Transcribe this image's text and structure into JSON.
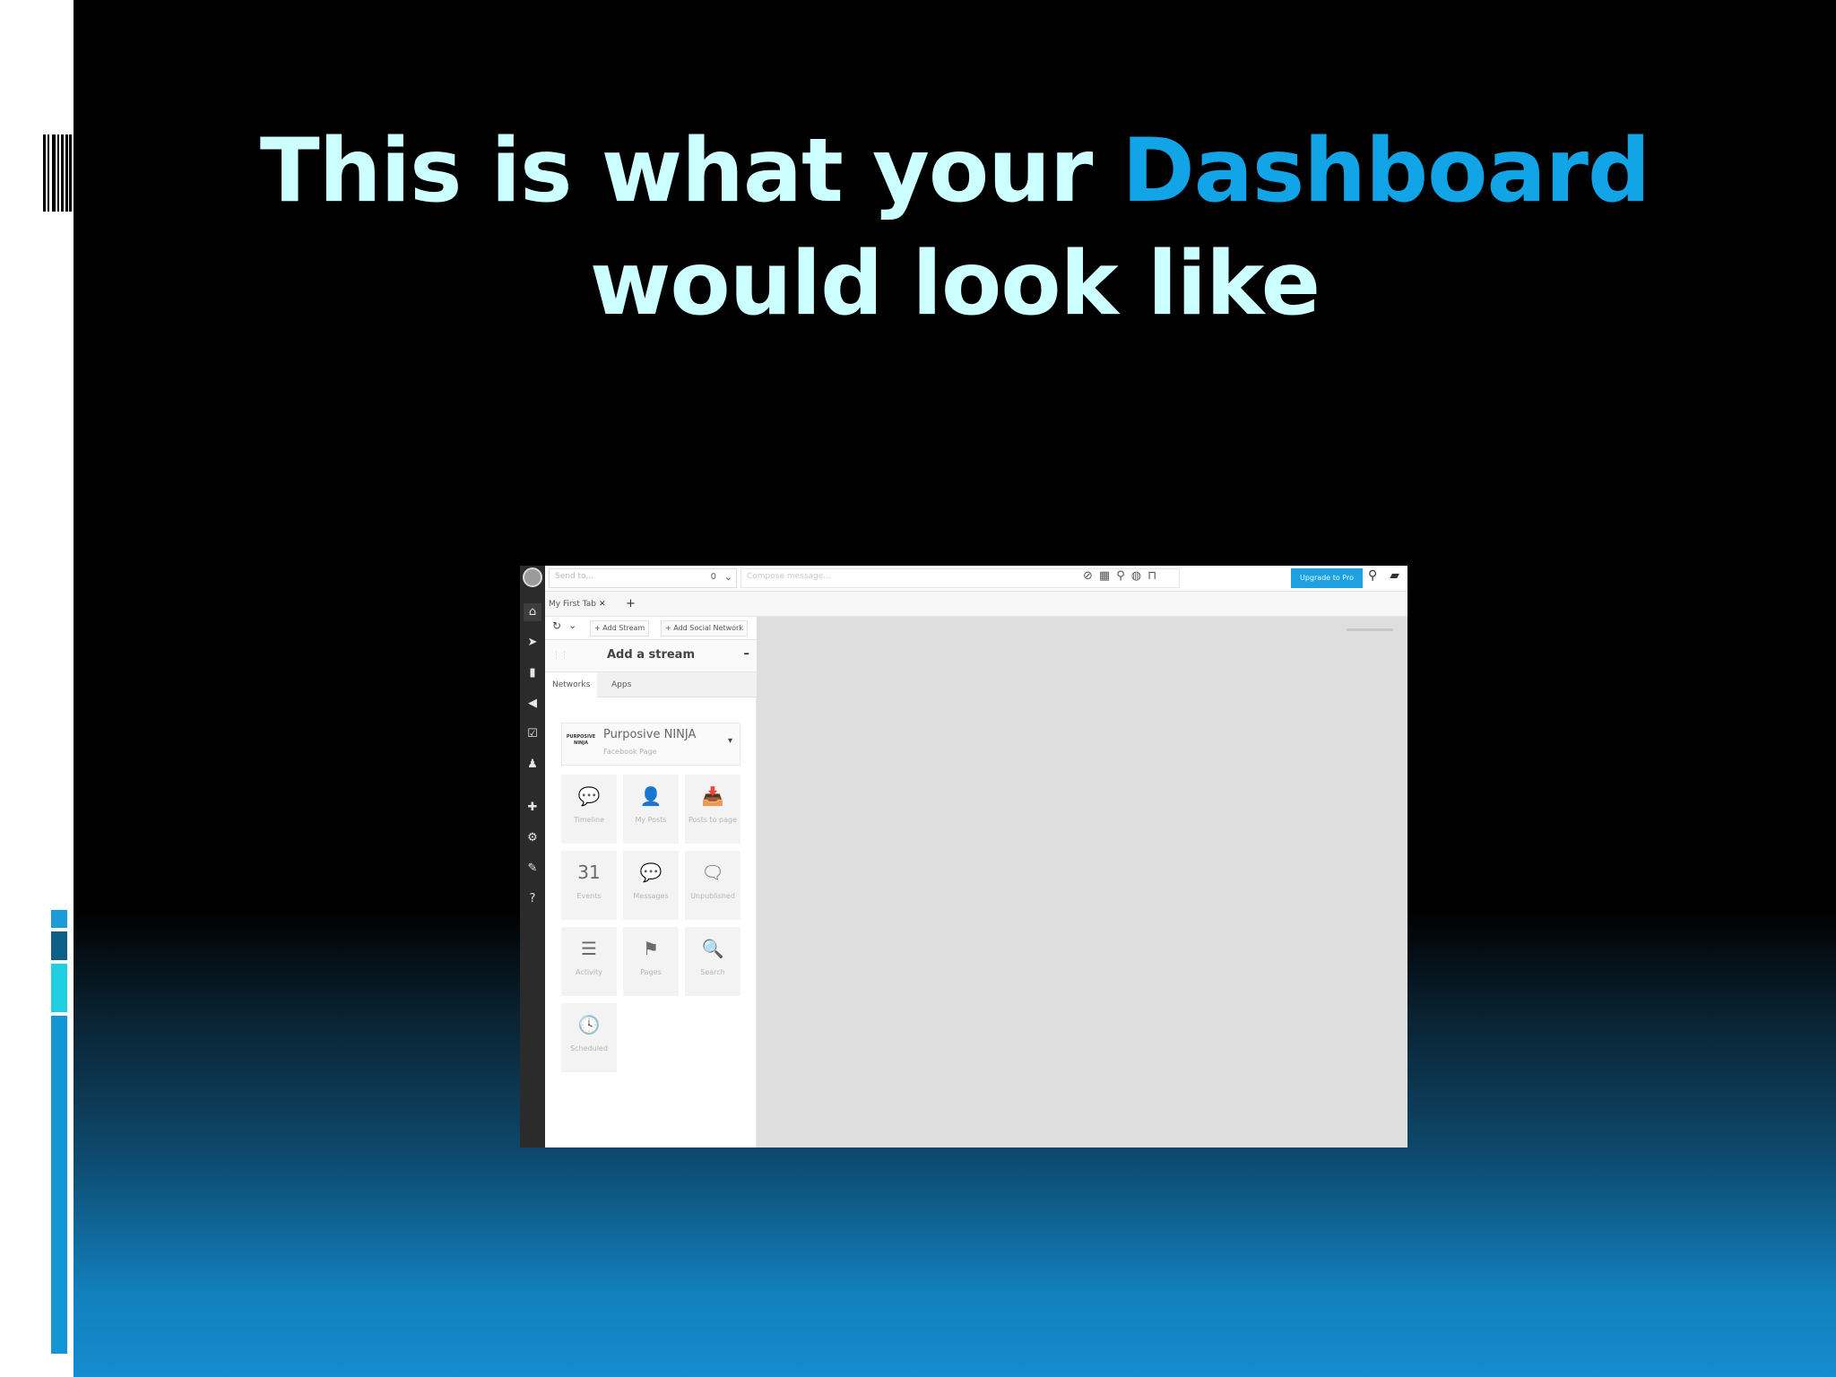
{
  "slide": {
    "title_line1_pre": "This is what your ",
    "title_highlight": "Dashboard",
    "title_line2": "would look like",
    "colors": {
      "title": "#ccffff",
      "highlight": "#11a4e6",
      "accent_bars": [
        "#1b9bd8",
        "#0e5f86",
        "#1fcfe0",
        "#1495d6"
      ]
    }
  },
  "dashboard": {
    "topbar": {
      "send_to_placeholder": "Send to...",
      "profile_count": "0",
      "compose_placeholder": "Compose message...",
      "compose_icons": [
        "attachment-icon",
        "calendar-icon",
        "location-pin-icon",
        "globe-icon",
        "lock-icon"
      ],
      "upgrade_label": "Upgrade to Pro",
      "right_icons": [
        "search-icon",
        "messages-icon"
      ]
    },
    "sidebar_icons": [
      "home-icon",
      "send-icon",
      "analytics-icon",
      "megaphone-icon",
      "assignments-icon",
      "contacts-icon",
      "apps-icon",
      "settings-icon",
      "tools-icon",
      "help-icon"
    ],
    "tabs": [
      {
        "label": "My First Tab"
      }
    ],
    "toolbar": {
      "add_stream_label": "Add Stream",
      "add_network_label": "Add Social Network"
    },
    "add_stream_panel": {
      "title": "Add a stream",
      "tabs": [
        "Networks",
        "Apps"
      ],
      "profile": {
        "logo_text": "PURPOSIVE NINJA",
        "name": "Purposive NINJA",
        "type": "Facebook Page"
      },
      "stream_types": [
        {
          "icon": "timeline-icon",
          "glyph": "💬",
          "label": "Timeline"
        },
        {
          "icon": "my-posts-icon",
          "glyph": "👤",
          "label": "My Posts"
        },
        {
          "icon": "posts-to-page-icon",
          "glyph": "📥",
          "label": "Posts to page"
        },
        {
          "icon": "events-icon",
          "glyph": "31",
          "label": "Events"
        },
        {
          "icon": "messages-icon",
          "glyph": "💬",
          "label": "Messages"
        },
        {
          "icon": "unpublished-icon",
          "glyph": "🗨",
          "label": "Unpublished"
        },
        {
          "icon": "activity-icon",
          "glyph": "☰",
          "label": "Activity"
        },
        {
          "icon": "pages-icon",
          "glyph": "⚑",
          "label": "Pages"
        },
        {
          "icon": "search-icon",
          "glyph": "🔍",
          "label": "Search"
        },
        {
          "icon": "scheduled-icon",
          "glyph": "🕓",
          "label": "Scheduled"
        }
      ]
    }
  }
}
